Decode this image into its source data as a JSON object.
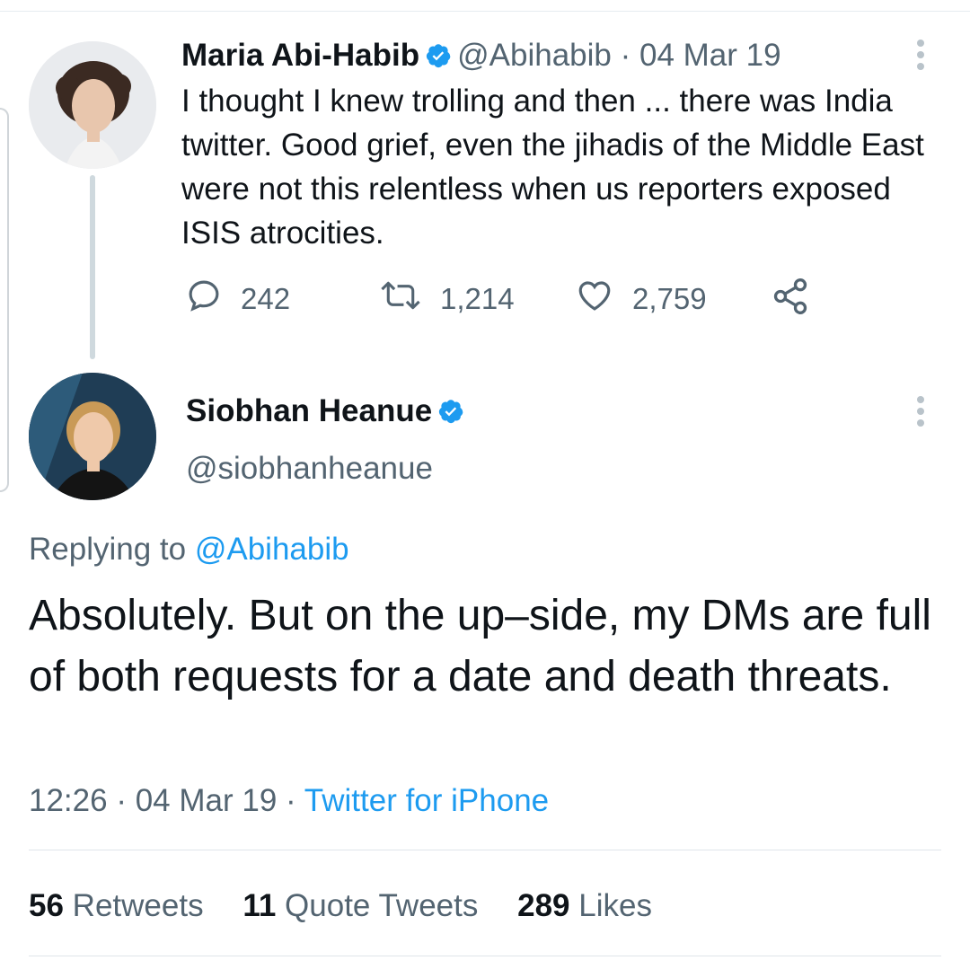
{
  "tweet1": {
    "name": "Maria Abi-Habib",
    "handle": "@Abihabib",
    "separator": " · ",
    "date": "04 Mar 19",
    "text": "I thought I knew trolling and then ... there was India twitter. Good grief, even the jihadis of the Middle East were not this relentless when us reporters exposed ISIS atrocities.",
    "replies": "242",
    "retweets": "1,214",
    "likes": "2,759"
  },
  "tweet2": {
    "name": "Siobhan Heanue",
    "handle": "@siobhanheanue",
    "replying_prefix": "Replying to ",
    "replying_to": "@Abihabib",
    "text": "Absolutely. But on the up–side, my DMs are full of both requests for a date and death threats.",
    "time": "12:26",
    "separator": " · ",
    "date": "04 Mar 19",
    "separator2": " · ",
    "source": "Twitter for iPhone",
    "stats": {
      "retweets_count": "56",
      "retweets_label": "Retweets",
      "quotes_count": "11",
      "quotes_label": "Quote Tweets",
      "likes_count": "289",
      "likes_label": "Likes"
    }
  },
  "colors": {
    "accent": "#1d9bf0",
    "muted": "#536471",
    "text": "#0f1419"
  },
  "icons": [
    "verified-badge-icon",
    "more-options-icon",
    "reply-icon",
    "retweet-icon",
    "like-icon",
    "share-icon"
  ]
}
